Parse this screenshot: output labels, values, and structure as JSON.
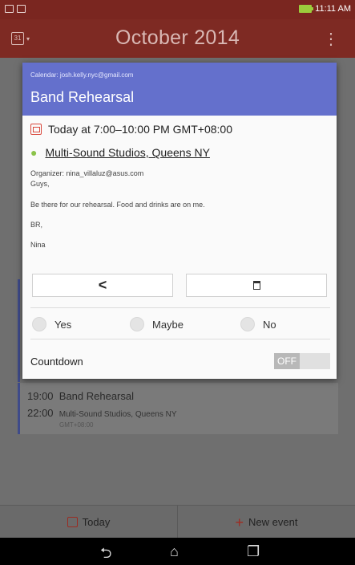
{
  "status_bar": {
    "time": "11:11 AM"
  },
  "app_bar": {
    "title": "October 2014",
    "calendar_icon_text": "31",
    "more_glyph": "⋮"
  },
  "dialog": {
    "calendar_label": "Calendar: josh.kelly.nyc@gmail.com",
    "title": "Band Rehearsal",
    "time": "Today at 7:00–10:00 PM  GMT+08:00",
    "location": "Multi-Sound Studios, Queens NY",
    "organizer": "Organizer: nina_villaluz@asus.com",
    "description": [
      "Guys,",
      "Be there for our rehearsal. Food and drinks are on me.",
      "BR,",
      "Nina"
    ],
    "share_glyph": "<",
    "rsvp": {
      "yes": "Yes",
      "maybe": "Maybe",
      "no": "No"
    },
    "countdown_label": "Countdown",
    "countdown_state": "OFF"
  },
  "background_event": {
    "start": "19:00",
    "title": "Band Rehearsal",
    "end": "22:00",
    "location": "Multi-Sound Studios, Queens NY",
    "timezone": "GMT+08:00"
  },
  "bottom_bar": {
    "today": "Today",
    "plus": "+",
    "new_event": "New event"
  },
  "nav_bar": {
    "back": "⮌",
    "home": "⌂",
    "recents": "❐"
  },
  "colors": {
    "accent_header": "#6470cc",
    "app_bar": "#7e2a23",
    "location_pin": "#8bc34a",
    "date_icon": "#d9473b"
  },
  "icons": [
    "calendar-icon",
    "more-icon",
    "date-icon",
    "location-pin-icon",
    "share-icon",
    "trash-icon",
    "back-icon",
    "home-icon",
    "recents-icon"
  ]
}
